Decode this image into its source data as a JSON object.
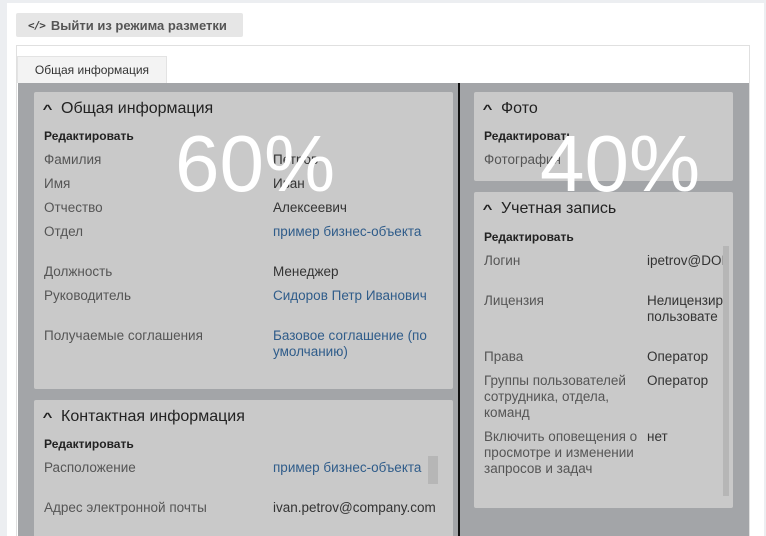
{
  "toolbar": {
    "exit_label": "Выйти из режима разметки",
    "exit_icon": "</>"
  },
  "tabs": [
    {
      "label": "Общая информация"
    }
  ],
  "overlay": {
    "left_percent": "60%",
    "right_percent": "40%"
  },
  "general": {
    "title": "Общая информация",
    "edit": "Редактировать",
    "fields": [
      {
        "label": "Фамилия",
        "value": "Петров"
      },
      {
        "label": "Имя",
        "value": "Иван"
      },
      {
        "label": "Отчество",
        "value": "Алексеевич"
      },
      {
        "label": "Отдел",
        "value": "пример бизнес-объекта"
      },
      {
        "label": "Должность",
        "value": "Менеджер"
      },
      {
        "label": "Руководитель",
        "value": "Сидоров Петр Иванович"
      },
      {
        "label": "Получаемые соглашения",
        "value": "Базовое соглашение (по умолчанию)"
      }
    ]
  },
  "contact": {
    "title": "Контактная информация",
    "edit": "Редактировать",
    "fields": [
      {
        "label": "Расположение",
        "value": "пример бизнес-объекта"
      },
      {
        "label": "Адрес электронной почты",
        "value": "ivan.petrov@company.com"
      }
    ]
  },
  "photo": {
    "title": "Фото",
    "edit": "Редактировать",
    "fields": [
      {
        "label": "Фотография"
      }
    ]
  },
  "account": {
    "title": "Учетная запись",
    "edit": "Редактировать",
    "fields": [
      {
        "label": "Логин",
        "value": "ipetrov@DOI"
      },
      {
        "label": "Лицензия",
        "value": "Нелицензир пользовате"
      },
      {
        "label": "Права",
        "value": "Оператор"
      },
      {
        "label": "Группы пользователей сотрудника, отдела, команд",
        "value": "Оператор"
      },
      {
        "label": "Включить оповещения о просмотре и изменении запросов и задач",
        "value": "нет"
      }
    ]
  }
}
